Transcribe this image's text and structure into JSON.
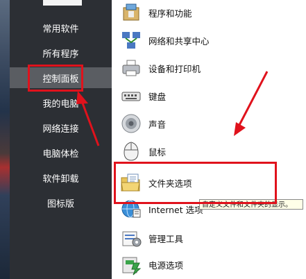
{
  "sidebar": {
    "items": [
      {
        "label": "常用软件"
      },
      {
        "label": "所有程序"
      },
      {
        "label": "控制面板"
      },
      {
        "label": "我的电脑"
      },
      {
        "label": "网络连接"
      },
      {
        "label": "电脑体检"
      },
      {
        "label": "软件卸载"
      },
      {
        "label": "图标版"
      }
    ]
  },
  "panel": {
    "items": [
      {
        "label": "程序和功能",
        "icon": "programs-features-icon"
      },
      {
        "label": "网络和共享中心",
        "icon": "network-sharing-icon"
      },
      {
        "label": "设备和打印机",
        "icon": "printer-icon"
      },
      {
        "label": "键盘",
        "icon": "keyboard-icon"
      },
      {
        "label": "声音",
        "icon": "speaker-icon"
      },
      {
        "label": "鼠标",
        "icon": "mouse-icon"
      },
      {
        "label": "文件夹选项",
        "icon": "folder-options-icon"
      },
      {
        "label": "Internet 选项",
        "icon": "internet-options-icon"
      },
      {
        "label": "管理工具",
        "icon": "admin-tools-icon"
      },
      {
        "label": "电源选项",
        "icon": "power-options-icon"
      }
    ]
  },
  "tooltip": {
    "text": "自定义文件和文件夹的显示。"
  },
  "colors": {
    "accent_red": "#e0121c",
    "menu_bg": "#2c2f34",
    "menu_active": "#5a5d62"
  }
}
